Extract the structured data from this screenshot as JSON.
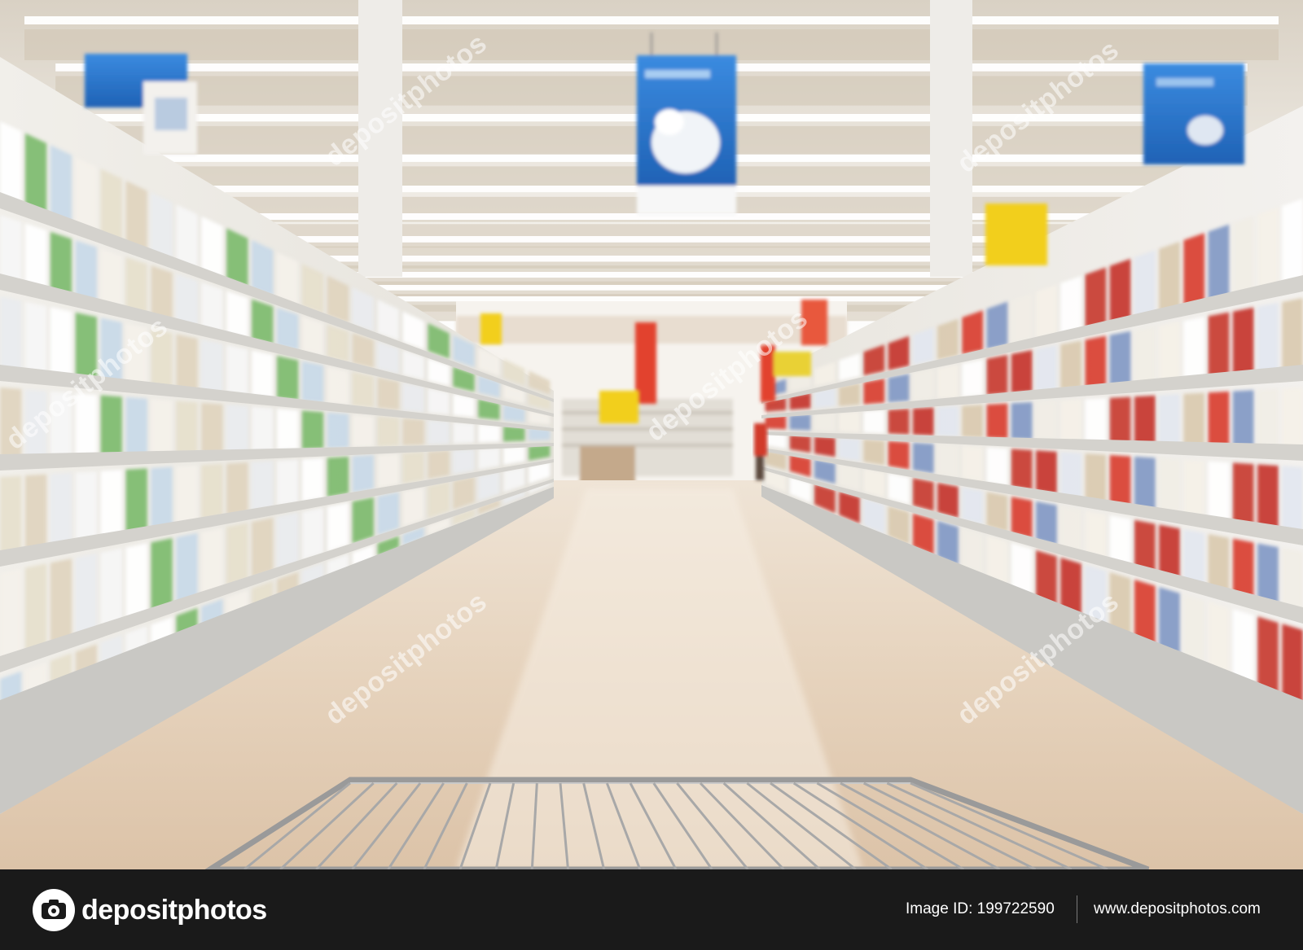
{
  "scene": {
    "description_name": "supermarket-aisle-photo",
    "colors": {
      "ceiling": "#e9e4dc",
      "floor": "#e8d6c2",
      "shelf": "#d9d9d6",
      "banner_blue": "#2f7fd6",
      "sign_red": "#e2432f",
      "sign_yellow": "#f2cf1b"
    }
  },
  "watermark": {
    "text": "depositphotos"
  },
  "footer": {
    "logo_text": "depositphotos",
    "logo_icon": "camera-icon",
    "image_id_label": "Image ID:",
    "image_id_value": "199722590",
    "site_url": "www.depositphotos.com"
  }
}
